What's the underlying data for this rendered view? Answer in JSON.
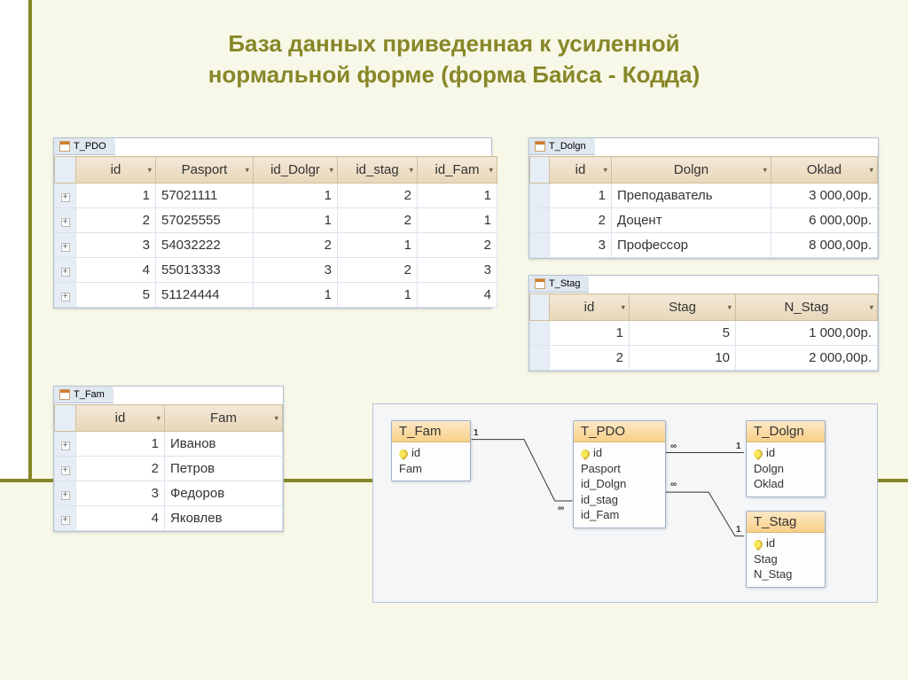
{
  "title_line1": "База данных приведенная к усиленной",
  "title_line2": "нормальной форме  (форма Байса - Кодда)",
  "tables": {
    "tPdo": {
      "tab": "T_PDO",
      "headers": [
        "id",
        "Pasport",
        "id_Dolgr",
        "id_stag",
        "id_Fam"
      ],
      "rows": [
        [
          "1",
          "57021111",
          "1",
          "2",
          "1"
        ],
        [
          "2",
          "57025555",
          "1",
          "2",
          "1"
        ],
        [
          "3",
          "54032222",
          "2",
          "1",
          "2"
        ],
        [
          "4",
          "55013333",
          "3",
          "2",
          "3"
        ],
        [
          "5",
          "51124444",
          "1",
          "1",
          "4"
        ]
      ]
    },
    "tDolgn": {
      "tab": "T_Dolgn",
      "headers": [
        "id",
        "Dolgn",
        "Oklad"
      ],
      "rows": [
        [
          "1",
          "Преподаватель",
          "3 000,00р."
        ],
        [
          "2",
          "Доцент",
          "6 000,00р."
        ],
        [
          "3",
          "Профессор",
          "8 000,00р."
        ]
      ]
    },
    "tStag": {
      "tab": "T_Stag",
      "headers": [
        "id",
        "Stag",
        "N_Stag"
      ],
      "rows": [
        [
          "1",
          "5",
          "1 000,00р."
        ],
        [
          "2",
          "10",
          "2 000,00р."
        ]
      ]
    },
    "tFam": {
      "tab": "T_Fam",
      "headers": [
        "id",
        "Fam"
      ],
      "rows": [
        [
          "1",
          "Иванов"
        ],
        [
          "2",
          "Петров"
        ],
        [
          "3",
          "Федоров"
        ],
        [
          "4",
          "Яковлев"
        ]
      ]
    }
  },
  "diagram": {
    "entities": {
      "tFam": {
        "title": "T_Fam",
        "fields": [
          {
            "n": "id",
            "pk": true
          },
          {
            "n": "Fam"
          }
        ]
      },
      "tPdo": {
        "title": "T_PDO",
        "fields": [
          {
            "n": "id",
            "pk": true
          },
          {
            "n": "Pasport"
          },
          {
            "n": "id_Dolgn"
          },
          {
            "n": "id_stag"
          },
          {
            "n": "id_Fam"
          }
        ]
      },
      "tDolgn": {
        "title": "T_Dolgn",
        "fields": [
          {
            "n": "id",
            "pk": true
          },
          {
            "n": "Dolgn"
          },
          {
            "n": "Oklad"
          }
        ]
      },
      "tStag": {
        "title": "T_Stag",
        "fields": [
          {
            "n": "id",
            "pk": true
          },
          {
            "n": "Stag"
          },
          {
            "n": "N_Stag"
          }
        ]
      }
    },
    "cardinality": {
      "one": "1",
      "many": "∞"
    }
  }
}
